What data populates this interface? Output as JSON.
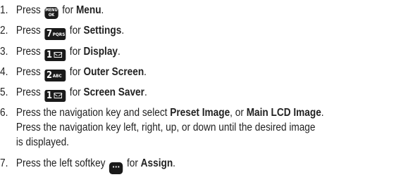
{
  "steps": [
    {
      "number": "1.",
      "lead": "Press",
      "key": {
        "type": "menu-ok-key",
        "top": "MENU",
        "bottom": "OK"
      },
      "connector": "for",
      "target": "Menu",
      "end": "."
    },
    {
      "number": "2.",
      "lead": "Press",
      "key": {
        "type": "digit-key",
        "digit": "7",
        "letters": "PQRS"
      },
      "connector": "for",
      "target": "Settings",
      "end": "."
    },
    {
      "number": "3.",
      "lead": "Press",
      "key": {
        "type": "digit-key",
        "digit": "1",
        "icon": "envelope-icon"
      },
      "connector": "for",
      "target": "Display",
      "end": "."
    },
    {
      "number": "4.",
      "lead": "Press",
      "key": {
        "type": "digit-key",
        "digit": "2",
        "letters": "ABC"
      },
      "connector": "for",
      "target": "Outer Screen",
      "end": "."
    },
    {
      "number": "5.",
      "lead": "Press",
      "key": {
        "type": "digit-key",
        "digit": "1",
        "icon": "envelope-icon"
      },
      "connector": "for",
      "target": "Screen Saver",
      "end": "."
    },
    {
      "number": "6.",
      "line1_lead": "Press the navigation key and select",
      "option1": "Preset Image",
      "line1_or": ", or",
      "option2": "Main LCD Image",
      "line1_end": ".",
      "line2": "Press the navigation key left, right, up, or down until the desired image",
      "line3": "is displayed."
    },
    {
      "number": "7.",
      "lead": "Press the left softkey",
      "key": {
        "type": "softkey",
        "symbol": "···"
      },
      "connector": "for",
      "target": "Assign",
      "end": "."
    }
  ]
}
